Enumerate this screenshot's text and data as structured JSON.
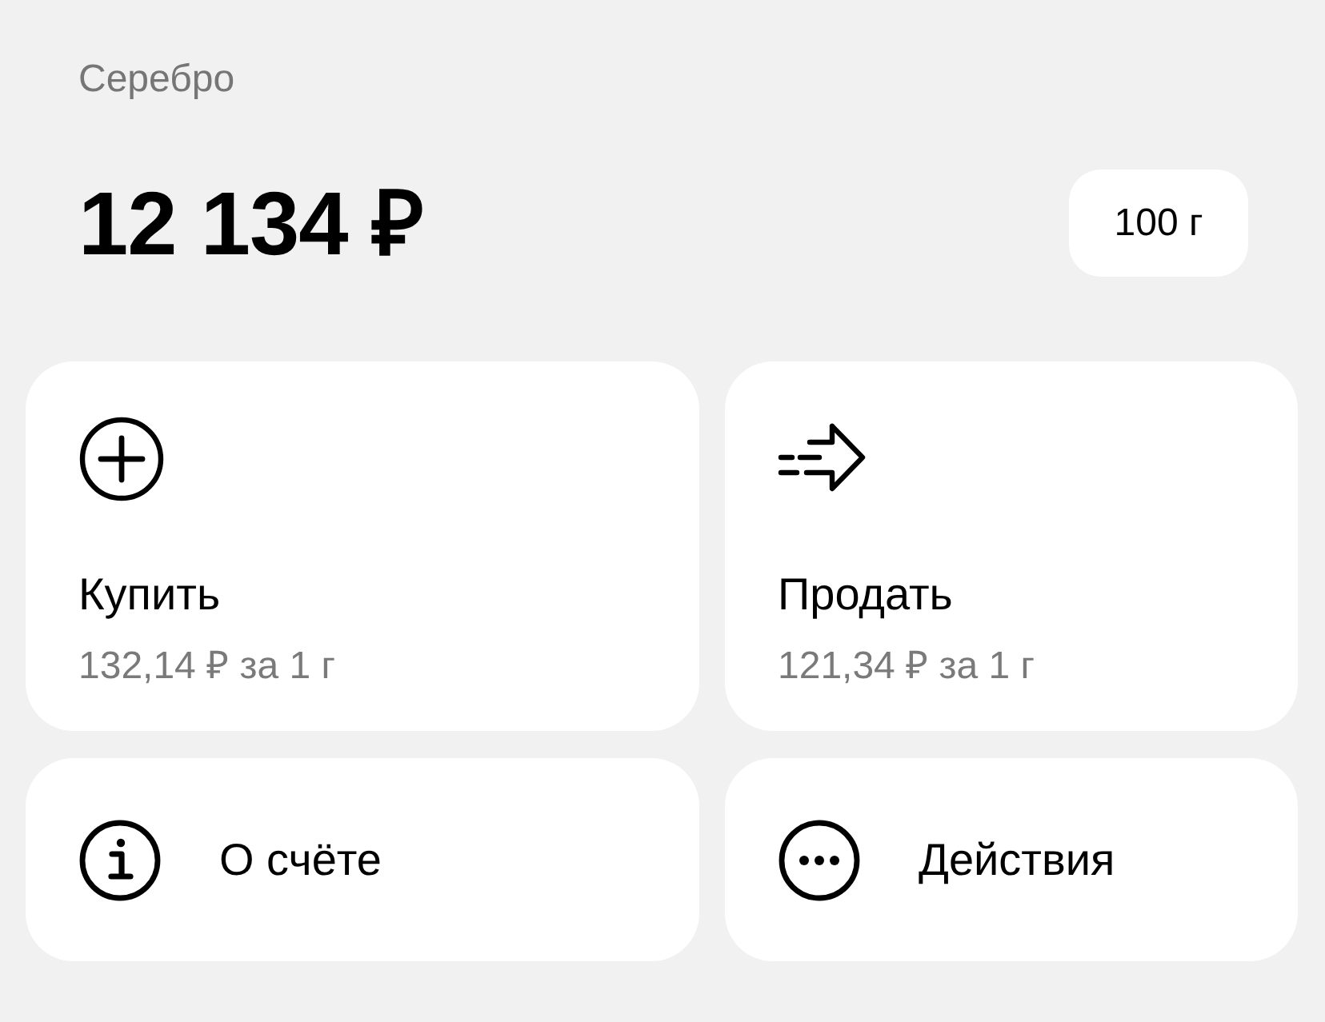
{
  "asset": {
    "title": "Серебро",
    "balance": "12 134 ₽",
    "unit": "100 г"
  },
  "actions": [
    {
      "kind": "buy",
      "label": "Купить",
      "price": "132,14 ₽ за 1 г"
    },
    {
      "kind": "sell",
      "label": "Продать",
      "price": "121,34 ₽ за 1 г"
    }
  ],
  "links": [
    {
      "kind": "info",
      "label": "О счёте"
    },
    {
      "kind": "more",
      "label": "Действия"
    }
  ]
}
